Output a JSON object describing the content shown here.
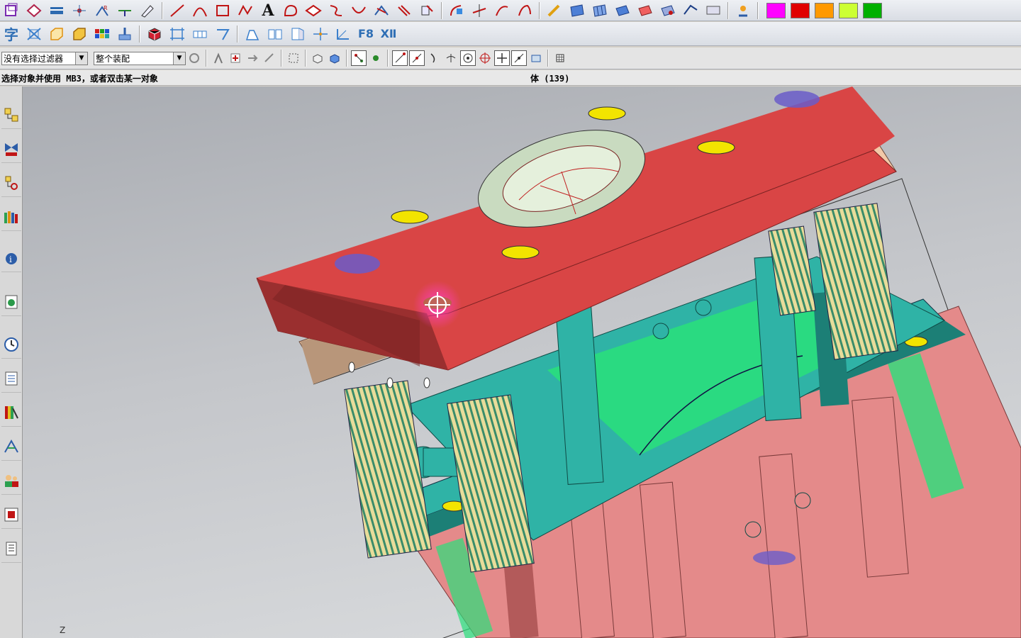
{
  "toolbar_top": {
    "icons": [
      "box-icon",
      "copy-cube-icon",
      "measure-icon",
      "point-icon",
      "zoom-r-icon",
      "datum-icon",
      "sketch-icon",
      "line-icon",
      "arc-icon",
      "rectangle-icon",
      "spline-icon",
      "text-a-icon",
      "curve-shape-icon",
      "offset-curve-icon",
      "project-icon",
      "bridge-icon",
      "trim-curve-icon",
      "extract-icon",
      "edit-curve-icon",
      "fillet-curve-icon",
      "split-icon",
      "wave-icon",
      "surface-icon",
      "mesh-icon",
      "sweep-icon",
      "thicken-icon",
      "offset-surface-icon",
      "trim-body-icon",
      "edit-surface-icon",
      "analysis-icon"
    ],
    "text_glyph": "A",
    "colors": [
      "#ff00ff",
      "#e00000",
      "#ff9900",
      "#ccff33",
      "#00b000"
    ]
  },
  "toolbar_second": {
    "glyph_labels": {
      "f8": "F8",
      "xii": "XⅡ"
    },
    "icons": [
      "char-icon",
      "trim-x-icon",
      "block-icon",
      "cube-icon",
      "color-grid-icon",
      "brush-icon",
      "red-cube-icon",
      "frame-icon",
      "bar-icon",
      "bend-icon",
      "move-icon",
      "pair-icon",
      "split-face-icon",
      "axis-cross-icon",
      "angle-icon",
      "f8-view-icon",
      "xii-icon"
    ]
  },
  "selection_bar": {
    "filter_value": "没有选择过滤器",
    "scope_value": "整个装配",
    "icons": [
      "refresh-icon",
      "hand-icon",
      "select-plus-icon",
      "arrow-icon",
      "arrow2-icon",
      "box-select-icon",
      "view-cube-icon",
      "shaded-cube-icon",
      "snap-all-icon",
      "snap-mid-icon",
      "end-point-icon",
      "mid-point-icon",
      "control-point-icon",
      "perp-icon",
      "center-icon",
      "quadrant-icon",
      "intersection-icon",
      "existing-point-icon",
      "point-on-curve-icon",
      "grid-icon"
    ]
  },
  "status": {
    "prompt": "选择对象并使用 MB3，或者双击某一对象",
    "selection": "体 (139)"
  },
  "sidebar": {
    "items": [
      "assembly-navigator-icon",
      "constraint-navigator-icon",
      "part-navigator-icon",
      "reuse-library-icon",
      "info-icon",
      "web-browser-icon",
      "history-icon",
      "process-icon",
      "palette-icon",
      "roles-icon",
      "systems-icon",
      "visual-report-icon",
      "print-icon"
    ]
  },
  "viewport": {
    "axis_label": "Z",
    "colors": {
      "top_plate": "#d94545",
      "top_plate_side": "#9a2f2f",
      "insulation": "#f3c9a8",
      "teal": "#2fb3a6",
      "teal_dark": "#1c7f76",
      "green": "#29e07a",
      "pink": "#e48a8a",
      "pink_dark": "#b35a5a",
      "yellow": "#f2e400",
      "blue": "#6a5cc9",
      "stripe": "#e8dc9a"
    }
  }
}
